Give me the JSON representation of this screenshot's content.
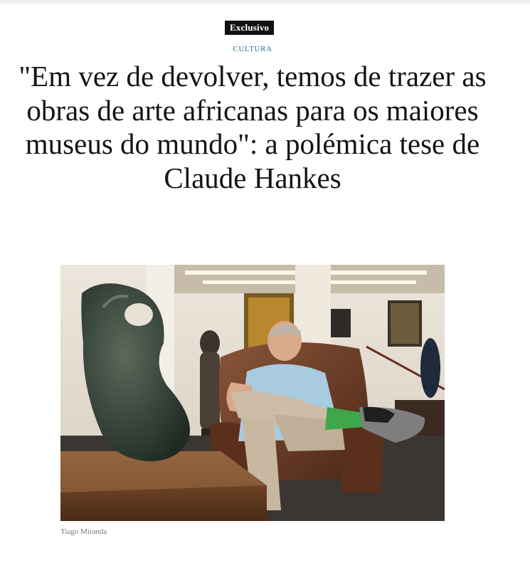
{
  "article": {
    "badge": "Exclusivo",
    "section": "CULTURA",
    "headline": "\"Em vez de devolver, temos de trazer as obras de arte africanas para os maiores museus do mundo\": a polémica tese de Claude Hankes",
    "photo_credit": "Tiago Miranda"
  },
  "colors": {
    "badge_bg": "#111111",
    "section_text": "#2a6f97",
    "credit_text": "#777777"
  }
}
